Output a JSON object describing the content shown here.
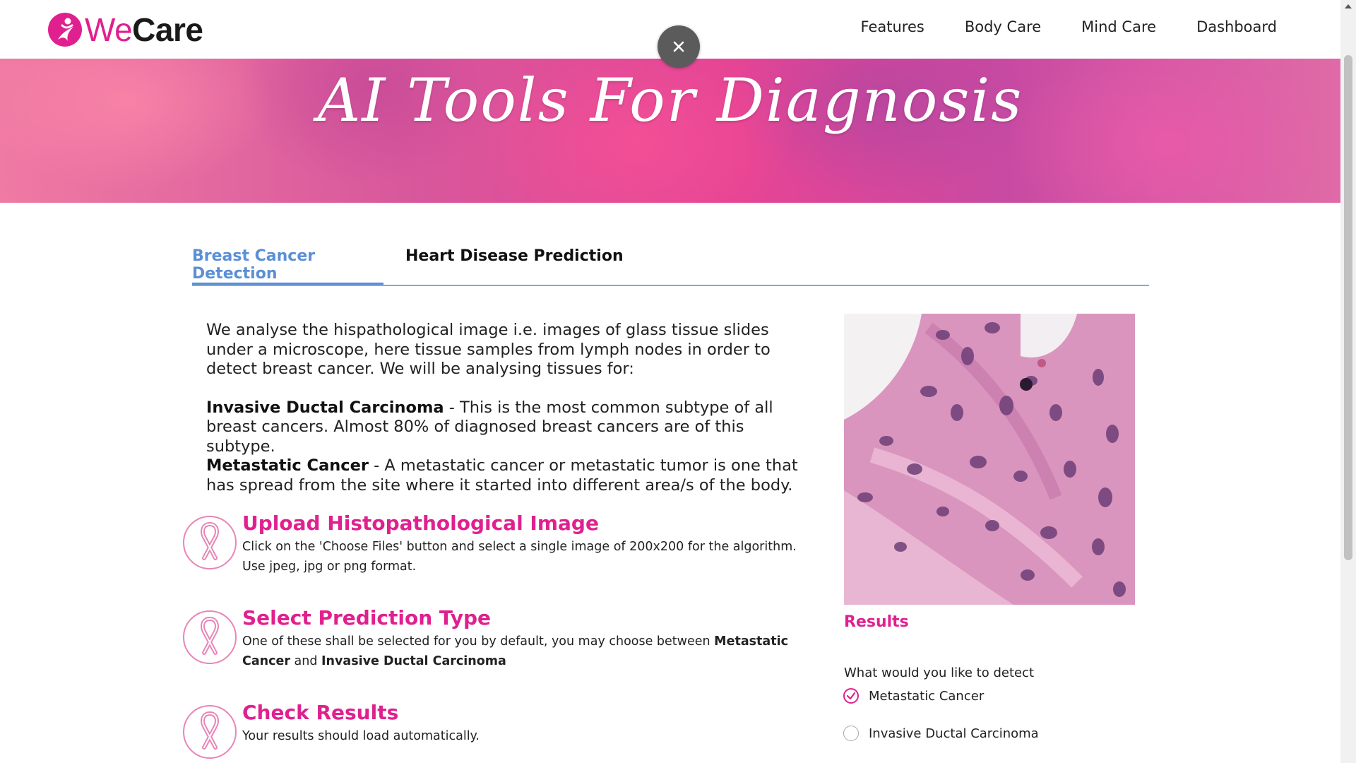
{
  "header": {
    "logo_we": "We",
    "logo_care": "Care",
    "nav": [
      "Features",
      "Body Care",
      "Mind Care",
      "Dashboard"
    ]
  },
  "hero": {
    "title": "AI Tools For Diagnosis"
  },
  "tabs": [
    {
      "label": "Breast Cancer Detection",
      "active": true
    },
    {
      "label": "Heart Disease Prediction",
      "active": false
    }
  ],
  "intro": {
    "paragraph": "We analyse the hispathological image i.e. images of glass tissue slides under a microscope, here tissue samples from lymph nodes in order to detect breast cancer. We will be analysing tissues for:",
    "idc_term": "Invasive Ductal Carcinoma",
    "idc_text": " - This is the most common subtype of all breast cancers. Almost 80% of diagnosed breast cancers are of this subtype.",
    "meta_term": "Metastatic Cancer",
    "meta_text": " - A metastatic cancer or metastatic tumor is one that has spread from the site where it started into different area/s of the body."
  },
  "steps": [
    {
      "title": "Upload Histopathological Image",
      "text": "Click on the 'Choose Files' button and select a single image of 200x200 for the algorithm. Use jpeg, jpg or png format."
    },
    {
      "title": "Select Prediction Type",
      "text_a": "One of these shall be selected for you by default, you may choose between ",
      "bold_a": "Metastatic Cancer",
      "text_b": " and ",
      "bold_b": "Invasive Ductal Carcinoma"
    },
    {
      "title": "Check Results",
      "text": "Your results should load automatically."
    }
  ],
  "results": {
    "title": "Results",
    "question": "What would you like to detect",
    "options": [
      {
        "label": "Metastatic Cancer",
        "checked": true
      },
      {
        "label": "Invasive Ductal Carcinoma",
        "checked": false
      }
    ]
  },
  "icons": {
    "logo": "pink-ribbon-woman-logo-icon",
    "close": "close-icon",
    "step": "pink-ribbon-icon",
    "checked": "check-circle-icon"
  },
  "colors": {
    "brand_pink": "#e0208f",
    "tab_blue": "#5b8fd6",
    "close_gray": "#5b5b5b"
  }
}
